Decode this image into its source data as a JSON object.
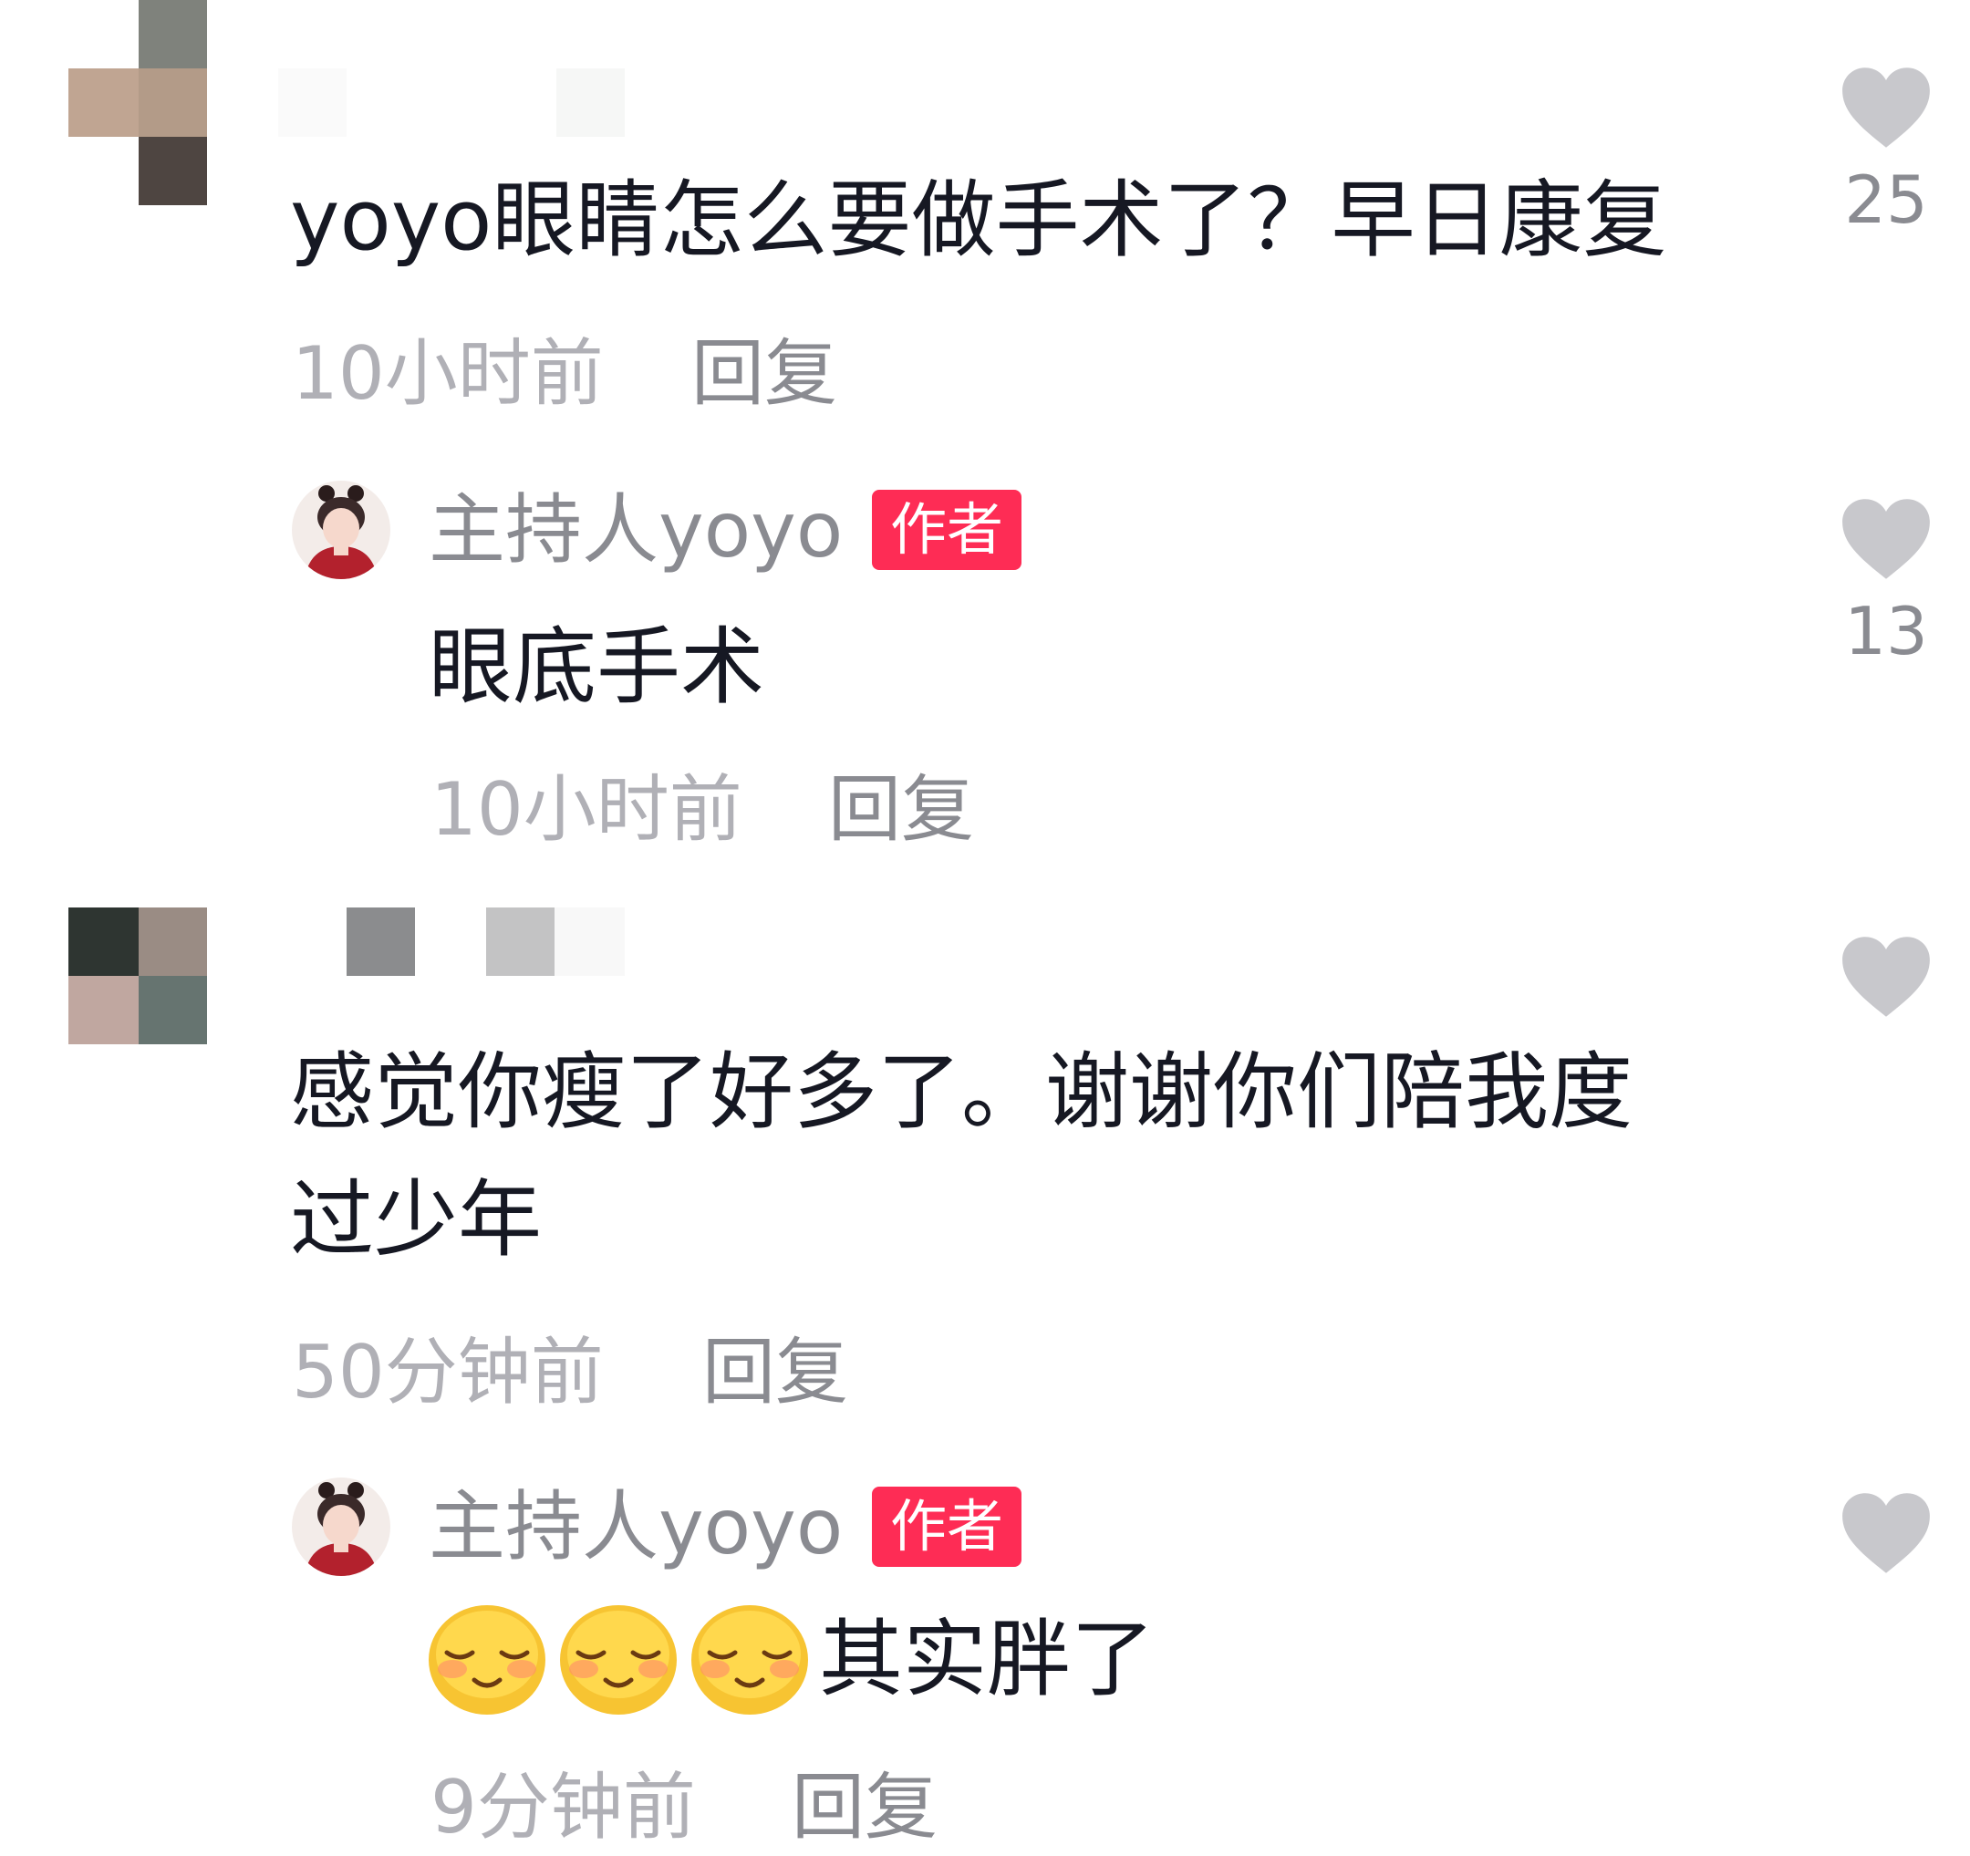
{
  "comments": [
    {
      "text": "yoyo眼睛怎么要做手术了？早日康复",
      "time": "10小时前",
      "reply_label": "回复",
      "likes": "25",
      "reply": {
        "author": "主持人yoyo",
        "badge": "作者",
        "text": "眼底手术",
        "time": "10小时前",
        "reply_label": "回复",
        "likes": "13"
      }
    },
    {
      "text_line1": "感觉你瘦了好多了。谢谢你们陪我度",
      "text_line2": "过少年",
      "time": "50分钟前",
      "reply_label": "回复",
      "likes": "",
      "reply": {
        "author": "主持人yoyo",
        "badge": "作者",
        "text": "其实胖了",
        "emojis": [
          "shy-smile-emoji",
          "shy-smile-emoji",
          "shy-smile-emoji"
        ],
        "time": "9分钟前",
        "reply_label": "回复",
        "likes": ""
      }
    }
  ],
  "colors": {
    "badge_bg": "#fe2c55",
    "text_primary": "#161823",
    "text_secondary": "#8a8b91",
    "heart": "#c8c8cc"
  },
  "icons": [
    "heart-icon",
    "avatar-pixelated",
    "avatar-host"
  ]
}
